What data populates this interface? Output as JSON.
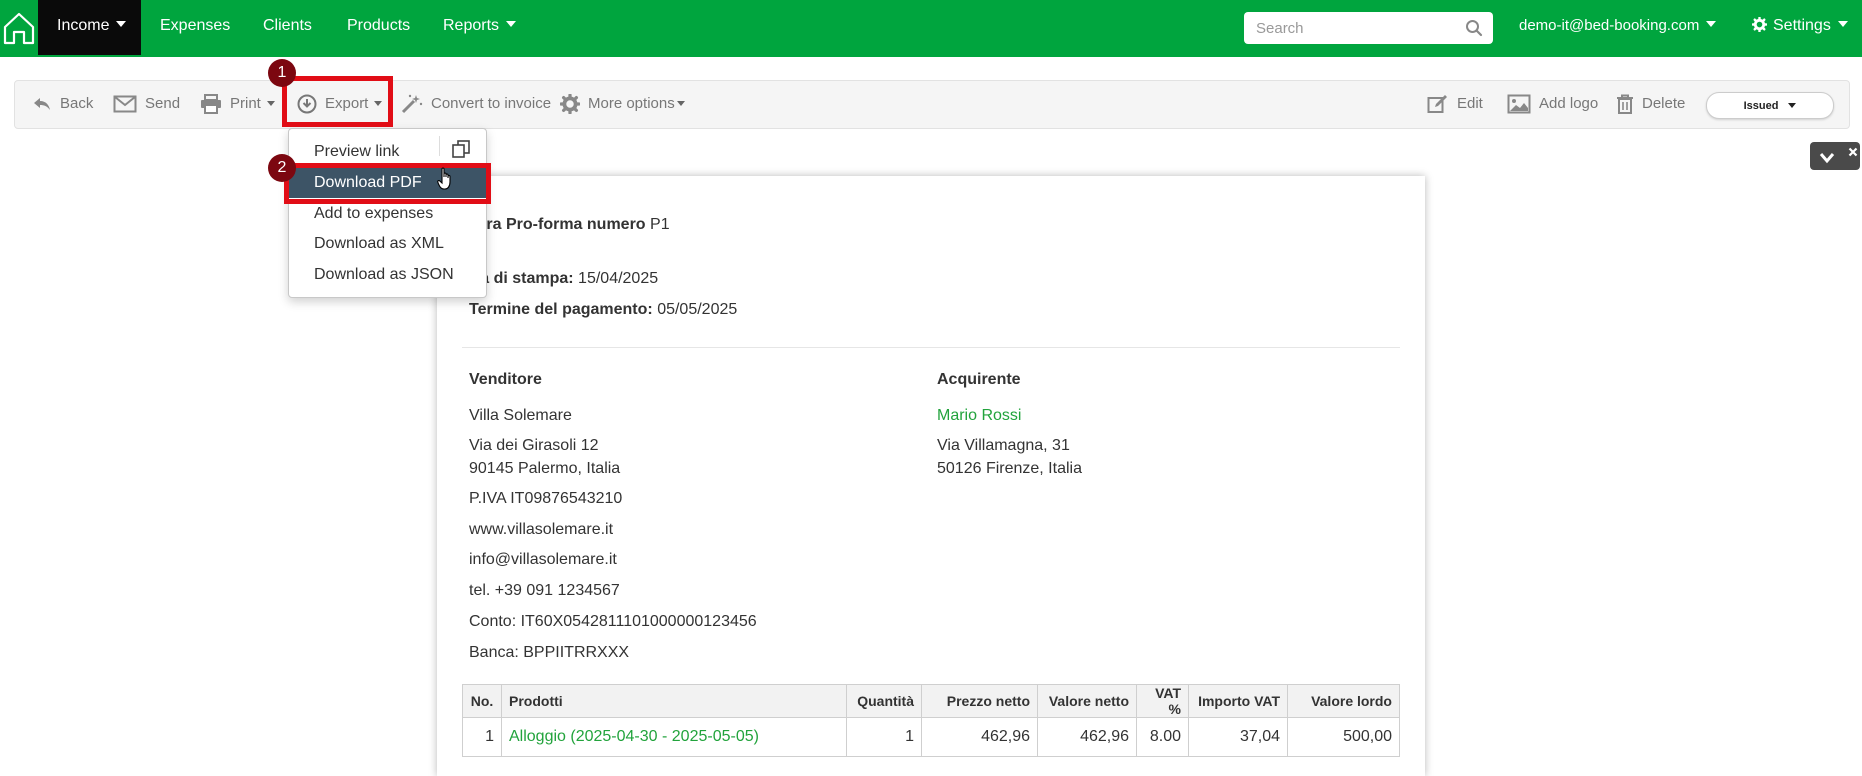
{
  "navbar": {
    "items": [
      {
        "label": "Income"
      },
      {
        "label": "Expenses"
      },
      {
        "label": "Clients"
      },
      {
        "label": "Products"
      },
      {
        "label": "Reports"
      }
    ],
    "search_placeholder": "Search",
    "account": "demo-it@bed-booking.com",
    "settings": "Settings"
  },
  "toolbar": {
    "back": "Back",
    "send": "Send",
    "print": "Print",
    "export": "Export",
    "convert": "Convert to invoice",
    "more": "More options",
    "edit": "Edit",
    "add_logo": "Add logo",
    "delete": "Delete",
    "status": "Issued"
  },
  "export_menu": {
    "items": [
      {
        "label": "Preview link"
      },
      {
        "label": "Download PDF"
      },
      {
        "label": "Add to expenses"
      },
      {
        "label": "Download as XML"
      },
      {
        "label": "Download as JSON"
      }
    ]
  },
  "annotations": {
    "step1": "1",
    "step2": "2"
  },
  "document": {
    "title_label": "ttura Pro-forma numero",
    "title_value": "P1",
    "print_date_label": "ata di stampa:",
    "print_date": "15/04/2025",
    "due_label": "Termine del pagamento:",
    "due_date": "05/05/2025",
    "seller": {
      "heading": "Venditore",
      "name": "Villa Solemare",
      "address1": "Via dei Girasoli 12",
      "address2": "90145 Palermo, Italia",
      "vat": "P.IVA IT09876543210",
      "web": "www.villasolemare.it",
      "email": "info@villasolemare.it",
      "phone": "tel. +39 091 1234567",
      "account": "Conto: IT60X0542811101000000123456",
      "bank": "Banca: BPPIITRRXXX"
    },
    "buyer": {
      "heading": "Acquirente",
      "name": "Mario Rossi",
      "address1": "Via Villamagna, 31",
      "address2": "50126 Firenze, Italia"
    },
    "table": {
      "headers": [
        "No.",
        "Prodotti",
        "Quantità",
        "Prezzo netto",
        "Valore netto",
        "VAT %",
        "Importo VAT",
        "Valore lordo"
      ],
      "rows": [
        [
          "1",
          "Alloggio (2025-04-30 - 2025-05-05)",
          "1",
          "462,96",
          "462,96",
          "8.00",
          "37,04",
          "500,00"
        ]
      ]
    }
  },
  "colors": {
    "navbar": "#00a53e",
    "active_nav": "#0a0a0a",
    "highlight": "#e10d16",
    "badge": "#7c0710",
    "menu_hover": "#3d5466",
    "link_green": "#22a33c"
  }
}
